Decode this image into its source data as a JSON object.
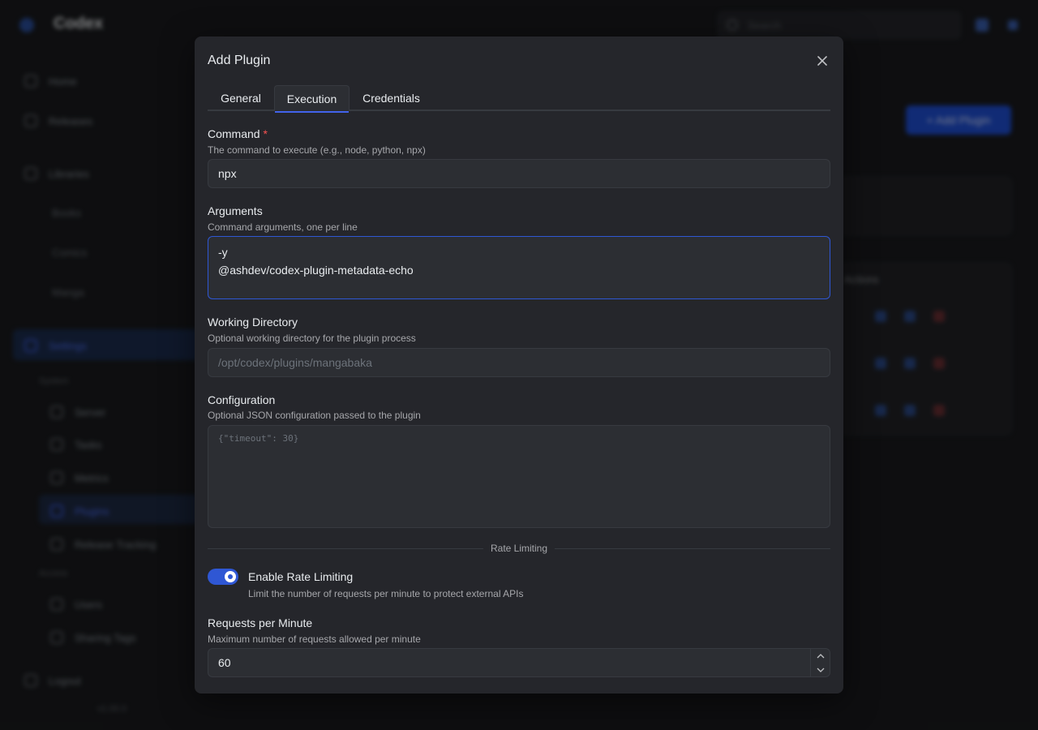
{
  "background": {
    "brand": "Codex",
    "search_placeholder": "Search",
    "nav": {
      "home": "Home",
      "releases": "Releases",
      "libraries": "Libraries",
      "books": "Books",
      "comics": "Comics",
      "manga": "Manga",
      "settings": "Settings",
      "system_label": "System",
      "server": "Server",
      "tasks": "Tasks",
      "metrics": "Metrics",
      "plugins": "Plugins",
      "release_tracking": "Release Tracking",
      "access_label": "Access",
      "users": "Users",
      "sharing_tags": "Sharing Tags",
      "logout": "Logout",
      "version": "v1.00.0"
    },
    "add_plugin_button": "+ Add Plugin",
    "table_header": "Actions"
  },
  "modal": {
    "title": "Add Plugin",
    "tabs": [
      {
        "label": "General"
      },
      {
        "label": "Execution"
      },
      {
        "label": "Credentials"
      }
    ],
    "active_tab": "Execution",
    "command": {
      "label": "Command",
      "required_mark": "*",
      "description": "The command to execute (e.g., node, python, npx)",
      "value": "npx"
    },
    "arguments": {
      "label": "Arguments",
      "description": "Command arguments, one per line",
      "value": "-y\n@ashdev/codex-plugin-metadata-echo"
    },
    "working_directory": {
      "label": "Working Directory",
      "description": "Optional working directory for the plugin process",
      "placeholder": "/opt/codex/plugins/mangabaka",
      "value": ""
    },
    "configuration": {
      "label": "Configuration",
      "description": "Optional JSON configuration passed to the plugin",
      "placeholder": "{\"timeout\": 30}",
      "value": ""
    },
    "rate_limiting": {
      "divider_label": "Rate Limiting",
      "toggle_label": "Enable Rate Limiting",
      "toggle_description": "Limit the number of requests per minute to protect external APIs",
      "enabled": true
    },
    "requests_per_minute": {
      "label": "Requests per Minute",
      "description": "Maximum number of requests allowed per minute",
      "value": "60"
    }
  },
  "colors": {
    "accent": "#2f57d4",
    "modal_bg": "#25262b",
    "required": "#fa5252"
  }
}
